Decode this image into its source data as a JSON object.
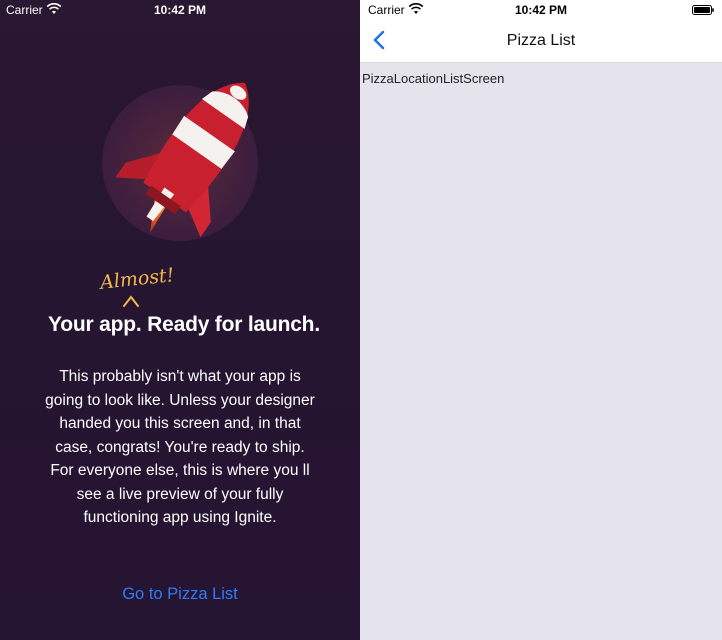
{
  "left_screen": {
    "status_bar": {
      "carrier": "Carrier",
      "time": "10:42 PM",
      "signal_icon": "wifi-icon"
    },
    "illustration": {
      "icon": "rocket-icon"
    },
    "tagline": "Almost!",
    "title": "Your app. Ready for launch.",
    "body_lines": [
      "This probably isn't what your app is",
      "going to look like. Unless your designer",
      "handed you this screen and, in that",
      "case, congrats! You're ready to ship.",
      "For everyone else, this is where you ll",
      "see a live preview of your fully",
      "functioning app using Ignite."
    ],
    "link_label": "Go to Pizza List",
    "colors": {
      "background": "#2a1731",
      "accent_text": "#f2b84b",
      "link": "#2f7cf6",
      "rocket_red": "#c8202e"
    }
  },
  "right_screen": {
    "status_bar": {
      "carrier": "Carrier",
      "time": "10:42 PM",
      "battery_icon": "battery-icon"
    },
    "nav": {
      "title": "Pizza List",
      "back_icon": "chevron-left-icon"
    },
    "content_label": "PizzaLocationListScreen",
    "colors": {
      "background": "#e5e4ec",
      "nav_tint": "#1f6fe8"
    }
  }
}
